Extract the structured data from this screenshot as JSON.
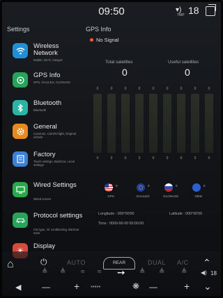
{
  "status": {
    "time": "09:50",
    "volume_label": "TMP",
    "volume": "18",
    "icons": [
      "volume-icon",
      "windows-icon"
    ]
  },
  "sidebar": {
    "title": "Settings",
    "items": [
      {
        "title": "Wireless Network",
        "subtitle": "Mobile, Wi-Fi, hotspot",
        "icon": "wifi-icon",
        "color": "#1f8fd6"
      },
      {
        "title": "GPS Info",
        "subtitle": "GPS, GALILEO, GLONASS",
        "icon": "satellite-icon",
        "color": "#27a35a"
      },
      {
        "title": "Bluetooth",
        "subtitle": "Bluetooth",
        "icon": "bluetooth-icon",
        "color": "#2bb3a3"
      },
      {
        "title": "General",
        "subtitle": "Common, Colorful light, Original vehicle",
        "icon": "gear-icon",
        "color": "#e58a1f"
      },
      {
        "title": "Factory",
        "subtitle": "Touch settings, BackCar, Local settings",
        "icon": "factory-icon",
        "color": "#3b82d6"
      },
      {
        "title": "Wired Settings",
        "subtitle": "Wired screen",
        "icon": "monitor-icon",
        "color": "#2aa84a"
      },
      {
        "title": "Protocol settings",
        "subtitle": "Car type, Air conditioning, Backcar track",
        "icon": "car-icon",
        "color": "#27a35a"
      },
      {
        "title": "Display",
        "subtitle": "",
        "icon": "display-icon",
        "color": "#d64a3b"
      }
    ]
  },
  "gps": {
    "title": "GPS Info",
    "status": "No Signal",
    "total_label": "Total satellites",
    "total_value": "0",
    "useful_label": "Useful satellites",
    "useful_value": "0",
    "bars": [
      {
        "value": "0",
        "id": "0"
      },
      {
        "value": "0",
        "id": "0"
      },
      {
        "value": "0",
        "id": "0"
      },
      {
        "value": "0",
        "id": "0"
      },
      {
        "value": "0",
        "id": "0"
      },
      {
        "value": "0",
        "id": "0"
      },
      {
        "value": "0",
        "id": "0"
      },
      {
        "value": "0",
        "id": "0"
      },
      {
        "value": "0",
        "id": "0"
      }
    ],
    "systems": [
      {
        "name": "GPS",
        "count": "0"
      },
      {
        "name": "GALILEO",
        "count": "0"
      },
      {
        "name": "GLONASS",
        "count": "0"
      },
      {
        "name": "Other",
        "count": "0"
      }
    ],
    "longitude": "Longitude : 000°00'00",
    "latitude": "Latitude : 000°00'00",
    "time": "Time : 0000-00-00 00:00:00"
  },
  "climate": {
    "auto": "AUTO",
    "rear": "REAR",
    "dual": "DUAL",
    "ac": "A/C",
    "temp": "18",
    "minus": "—",
    "plus": "+"
  }
}
